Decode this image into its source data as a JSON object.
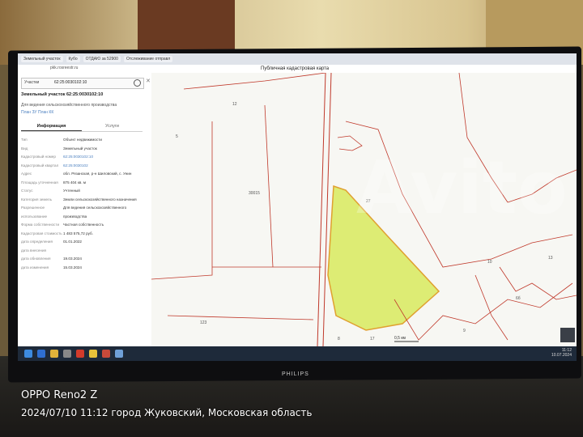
{
  "browser": {
    "tabs": [
      "Земельный участок",
      "Кубо",
      "ОТДАЮ за 52900",
      "Отслеживание отправл"
    ],
    "url": "pkk.rosreestr.ru",
    "map_title": "Публичная кадастровая карта"
  },
  "panel": {
    "search_label": "Участки",
    "search_value": "62:25:0030102:10",
    "title": "Земельный участок 62:25:0030102:10",
    "subtitle": "Для ведения сельскохозяйственного производства",
    "links": "План ЗУ   План КК",
    "tabs": [
      "Информация",
      "Услуги"
    ],
    "rows": [
      {
        "k": "Тип",
        "v": "Объект недвижимости"
      },
      {
        "k": "Вид",
        "v": "Земельный участок"
      },
      {
        "k": "Кадастровый номер",
        "v": "62:25:0030102:10"
      },
      {
        "k": "Кадастровый квартал",
        "v": "62:25:0030102"
      },
      {
        "k": "Адрес",
        "v": "обл. Рязанская, р-н Шиловский, с. Унин"
      },
      {
        "k": "Площадь уточненная",
        "v": "875 404 кв. м"
      },
      {
        "k": "Статус",
        "v": "Учтенный"
      },
      {
        "k": "Категория земель",
        "v": "Земли сельскохозяйственного назначения"
      },
      {
        "k": "Разрешенное использование",
        "v": "Для ведения сельскохозяйственного производства"
      },
      {
        "k": "Форма собственности",
        "v": "Частная собственность"
      },
      {
        "k": "Кадастровая стоимость",
        "v": "1 483 575,72 руб."
      },
      {
        "k": "дата определения",
        "v": "01.01.2022"
      },
      {
        "k": "дата внесения",
        "v": ""
      },
      {
        "k": "дата обновления",
        "v": "19.03.2024"
      },
      {
        "k": "дата изменения",
        "v": "15.03.2024"
      }
    ]
  },
  "map": {
    "labels": [
      "5",
      "12",
      "30015",
      "123",
      "27",
      "17",
      "6б",
      "10",
      "13",
      "8",
      "9"
    ],
    "scale": "0,5 км"
  },
  "taskbar": {
    "time": "11:12",
    "date": "10.07.2024"
  },
  "monitor_brand": "PHILIPS",
  "watermark": "Avito",
  "photo_stamp": {
    "model": "OPPO Reno2 Z",
    "meta": "2024/07/10 11:12  город Жуковский, Московская область"
  },
  "colors": {
    "parcel_fill": "#d4e84a",
    "boundary": "#c0392b",
    "selection": "#e0a030"
  }
}
